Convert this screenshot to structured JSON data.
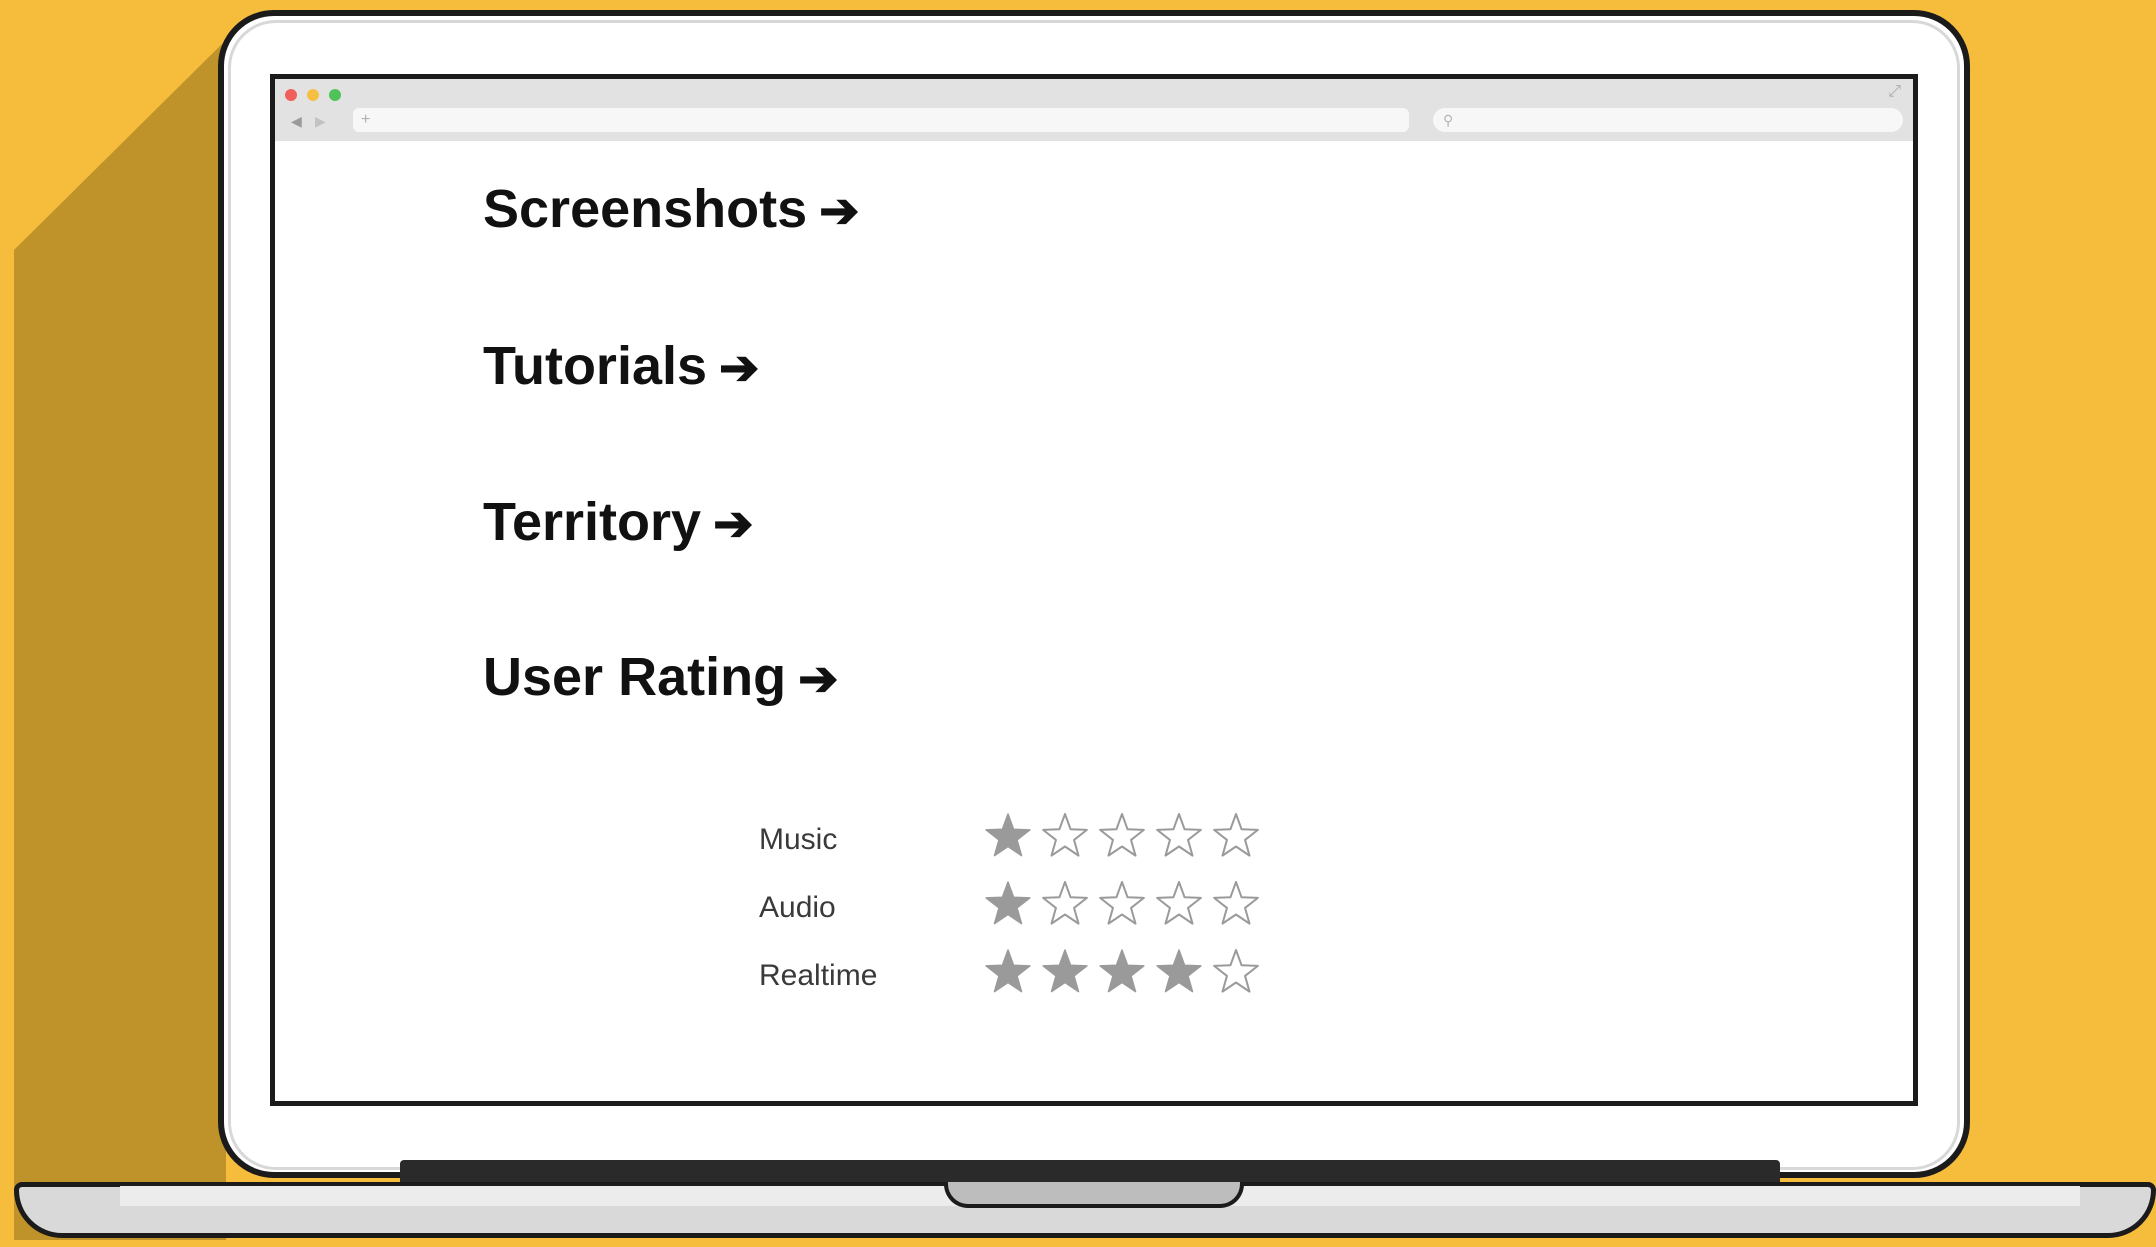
{
  "browser": {
    "window_controls": [
      "close",
      "minimize",
      "maximize"
    ],
    "nav_back_icon": "back-arrow-icon",
    "nav_forward_icon": "forward-arrow-icon",
    "url_plus": "+",
    "url_value": "",
    "search_value": "",
    "back_glyph": "◀",
    "forward_glyph": "▶",
    "search_glyph": "⚲",
    "expand_glyph": "⤢"
  },
  "sections": {
    "screenshots": "Screenshots",
    "tutorials": "Tutorials",
    "territory": "Territory",
    "user_rating": "User Rating",
    "arrow": "➔"
  },
  "ratings": [
    {
      "label": "Music",
      "value": 1,
      "max": 5
    },
    {
      "label": "Audio",
      "value": 1,
      "max": 5
    },
    {
      "label": "Realtime",
      "value": 4,
      "max": 5
    }
  ],
  "colors": {
    "background": "#F6BD3C",
    "star_filled": "#9a9a9a",
    "star_empty_stroke": "#9a9a9a"
  }
}
